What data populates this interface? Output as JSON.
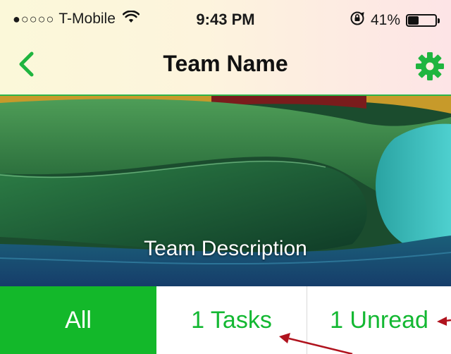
{
  "status_bar": {
    "signal_dots": "●○○○○",
    "carrier": "T-Mobile",
    "time": "9:43 PM",
    "battery_percent": "41%",
    "battery_level": 0.41,
    "icons": [
      "wifi-icon",
      "rotation-lock-icon",
      "battery-icon"
    ]
  },
  "nav": {
    "title": "Team Name",
    "back_icon": "chevron-left-icon",
    "settings_icon": "gear-icon"
  },
  "banner": {
    "description": "Team Description"
  },
  "segments": [
    {
      "label": "All",
      "selected": true
    },
    {
      "label": "1 Tasks",
      "selected": false
    },
    {
      "label": "1 Unread",
      "selected": false
    }
  ],
  "colors": {
    "accent": "#13b82a",
    "annotation_arrow": "#b0131e"
  }
}
